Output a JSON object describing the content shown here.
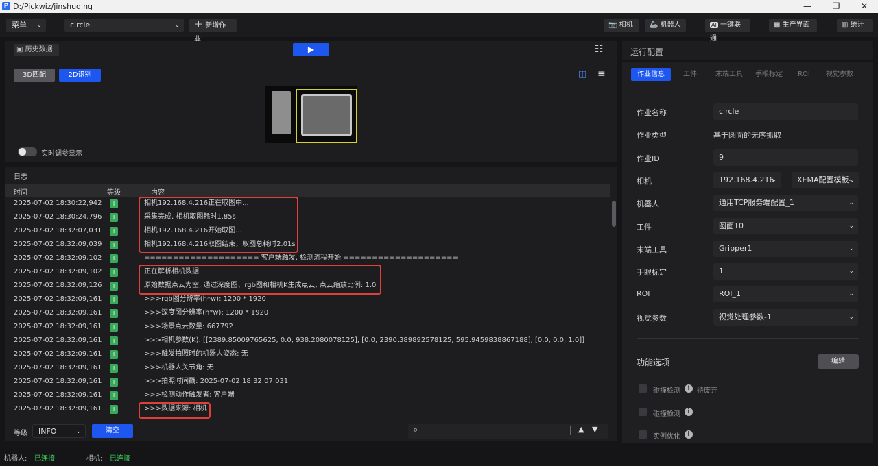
{
  "window": {
    "title": "D:/Pickwiz/jinshuding",
    "minimize": "—",
    "maximize": "❐",
    "close": "✕"
  },
  "toolbar": {
    "menu": "菜单",
    "job_select": "circle",
    "new_job": "新增作业",
    "camera": "相机",
    "robot": "机器人",
    "one_click": "一键联通",
    "production": "生产界面",
    "stats": "统计"
  },
  "left": {
    "history": "历史数据",
    "tab_3d": "3D匹配",
    "tab_2d": "2D识别",
    "realtime_toggle": "实时调参显示"
  },
  "log": {
    "title": "日志",
    "col_time": "时间",
    "col_level": "等级",
    "col_content": "内容",
    "level_label": "等级",
    "level_value": "INFO",
    "clear": "清空",
    "rows": [
      {
        "time": "2025-07-02 18:30:22,942",
        "level": "I",
        "content": "相机192.168.4.216正在取图中..."
      },
      {
        "time": "2025-07-02 18:30:24,796",
        "level": "I",
        "content": "采集完成, 相机取图耗时1.85s"
      },
      {
        "time": "2025-07-02 18:32:07,031",
        "level": "I",
        "content": "相机192.168.4.216开始取图..."
      },
      {
        "time": "2025-07-02 18:32:09,039",
        "level": "I",
        "content": "相机192.168.4.216取图结束，取图总耗时2.01s"
      },
      {
        "time": "2025-07-02 18:32:09,102",
        "level": "I",
        "content": "==================== 客户端触发, 检测流程开始 ===================="
      },
      {
        "time": "2025-07-02 18:32:09,102",
        "level": "I",
        "content": "正在解析相机数据"
      },
      {
        "time": "2025-07-02 18:32:09,126",
        "level": "I",
        "content": "原始数据点云为空, 通过深度图、rgb图和相机K生成点云, 点云缩放比例: 1.0"
      },
      {
        "time": "2025-07-02 18:32:09,161",
        "level": "I",
        "content": ">>>rgb图分辨率(h*w): 1200 * 1920"
      },
      {
        "time": "2025-07-02 18:32:09,161",
        "level": "I",
        "content": ">>>深度图分辨率(h*w): 1200 * 1920"
      },
      {
        "time": "2025-07-02 18:32:09,161",
        "level": "I",
        "content": ">>>场景点云数量: 667792"
      },
      {
        "time": "2025-07-02 18:32:09,161",
        "level": "I",
        "content": ">>>相机参数(K): [[2389.85009765625, 0.0, 938.2080078125], [0.0, 2390.389892578125, 595.9459838867188], [0.0, 0.0, 1.0]]"
      },
      {
        "time": "2025-07-02 18:32:09,161",
        "level": "I",
        "content": ">>>触发拍照时的机器人姿态: 无"
      },
      {
        "time": "2025-07-02 18:32:09,161",
        "level": "I",
        "content": ">>>机器人关节角: 无"
      },
      {
        "time": "2025-07-02 18:32:09,161",
        "level": "I",
        "content": ">>>拍照时间戳: 2025-07-02 18:32:07.031"
      },
      {
        "time": "2025-07-02 18:32:09,161",
        "level": "I",
        "content": ">>>检测动作触发者: 客户端"
      },
      {
        "time": "2025-07-02 18:32:09,161",
        "level": "I",
        "content": ">>>数据来源: 相机"
      }
    ]
  },
  "right": {
    "title": "运行配置",
    "tabs": [
      "作业信息",
      "工件",
      "末端工具",
      "手眼标定",
      "ROI",
      "视觉参数"
    ],
    "fields": [
      {
        "label": "作业名称",
        "value": "circle"
      },
      {
        "label": "作业类型",
        "value": "基于圆面的无序抓取"
      },
      {
        "label": "作业ID",
        "value": "9"
      },
      {
        "label": "相机",
        "value": "192.168.4.216",
        "value2": "XEMA配置模板-"
      },
      {
        "label": "机器人",
        "value": "通用TCP服务端配置_1"
      },
      {
        "label": "工件",
        "value": "圆面10"
      },
      {
        "label": "末端工具",
        "value": "Gripper1"
      },
      {
        "label": "手眼标定",
        "value": "1"
      },
      {
        "label": "ROI",
        "value": "ROI_1"
      },
      {
        "label": "视觉参数",
        "value": "视觉处理参数-1"
      }
    ],
    "func_title": "功能选项",
    "edit": "编辑",
    "options": [
      {
        "label": "碰撞检测",
        "note": "待废弃"
      },
      {
        "label": "碰撞检测"
      },
      {
        "label": "实例优化"
      }
    ]
  },
  "status": {
    "robot_label": "机器人:",
    "robot_value": "已连接",
    "camera_label": "相机:",
    "camera_value": "已连接"
  },
  "colors": {
    "accent": "#1e56f0",
    "connected": "#3ccf5a",
    "highlight": "#e0403c"
  }
}
